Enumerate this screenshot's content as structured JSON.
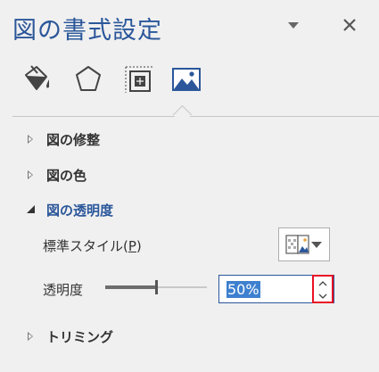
{
  "pane": {
    "title": "図の書式設定"
  },
  "tabs": [
    {
      "icon": "fill-bucket-icon"
    },
    {
      "icon": "pentagon-effects-icon"
    },
    {
      "icon": "size-properties-icon"
    },
    {
      "icon": "picture-icon",
      "selected": true
    }
  ],
  "sections": {
    "correction": {
      "label": "図の修整",
      "expanded": false
    },
    "color": {
      "label": "図の色",
      "expanded": false
    },
    "transparency": {
      "label": "図の透明度",
      "expanded": true
    },
    "crop": {
      "label": "トリミング",
      "expanded": false
    }
  },
  "transparency": {
    "preset_label": "標準スタイル(",
    "preset_accel": "P",
    "preset_label_end": ")",
    "amount_label": "透明度",
    "value": "50%",
    "slider_fraction": 0.5
  },
  "colors": {
    "accent": "#2b579a",
    "highlight": "#e81123",
    "selection": "#3d80cf"
  }
}
